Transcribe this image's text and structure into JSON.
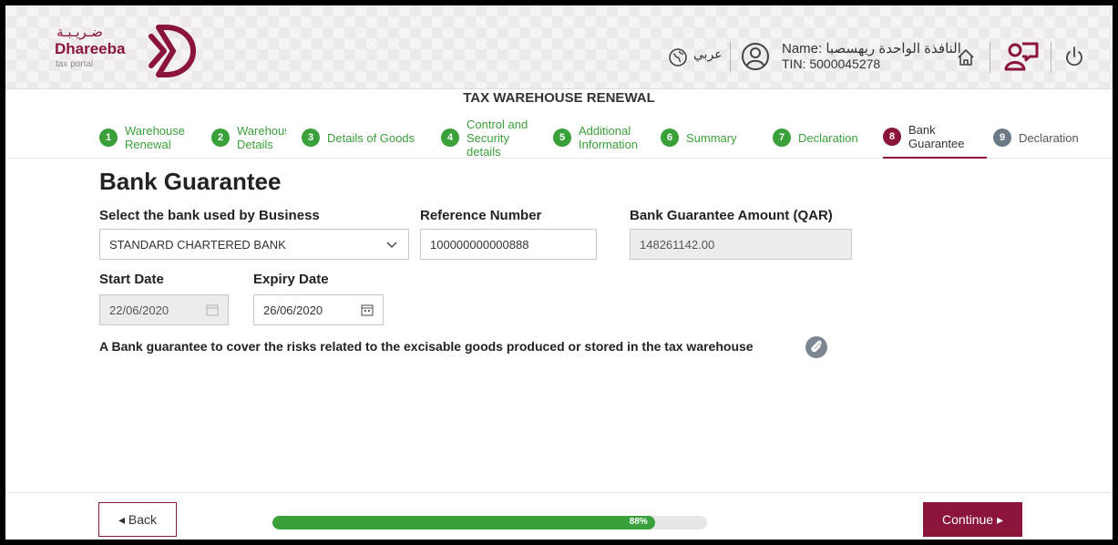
{
  "logo": {
    "arabic": "ضـريـبـة",
    "name": "Dhareeba",
    "sub": "tax portal"
  },
  "header": {
    "language": "عربي",
    "user_name": "Name: النافذة الواحدة ريهسصبا",
    "user_tin": "TIN: 5000045278"
  },
  "page_title": "TAX WAREHOUSE RENEWAL",
  "steps": [
    {
      "num": "1",
      "label": "Warehouse\nRenewal"
    },
    {
      "num": "2",
      "label": "Warehous\nDetails"
    },
    {
      "num": "3",
      "label": "Details of Goods"
    },
    {
      "num": "4",
      "label": "Control and\nSecurity\ndetails"
    },
    {
      "num": "5",
      "label": "Additional\nInformation"
    },
    {
      "num": "6",
      "label": "Summary"
    },
    {
      "num": "7",
      "label": "Declaration"
    },
    {
      "num": "8",
      "label": "Bank\nGuarantee"
    },
    {
      "num": "9",
      "label": "Declaration"
    }
  ],
  "form": {
    "heading": "Bank Guarantee",
    "bank_label": "Select the bank used by Business",
    "bank_value": "STANDARD CHARTERED BANK",
    "ref_label": "Reference Number",
    "ref_value": "100000000000888",
    "amount_label": "Bank Guarantee Amount (QAR)",
    "amount_value": "148261142.00",
    "start_label": "Start Date",
    "start_value": "22/06/2020",
    "expiry_label": "Expiry Date",
    "expiry_value": "26/06/2020",
    "note": "A Bank guarantee to cover the risks related to the excisable goods produced or stored in the tax warehouse"
  },
  "footer": {
    "back_label": "◂  Back",
    "continue_label": "Continue  ▸",
    "progress_percent": 88,
    "progress_text": "88%"
  },
  "colors": {
    "brand": "#8a1538",
    "success": "#3aa03a",
    "inactive": "#6c7a86"
  }
}
